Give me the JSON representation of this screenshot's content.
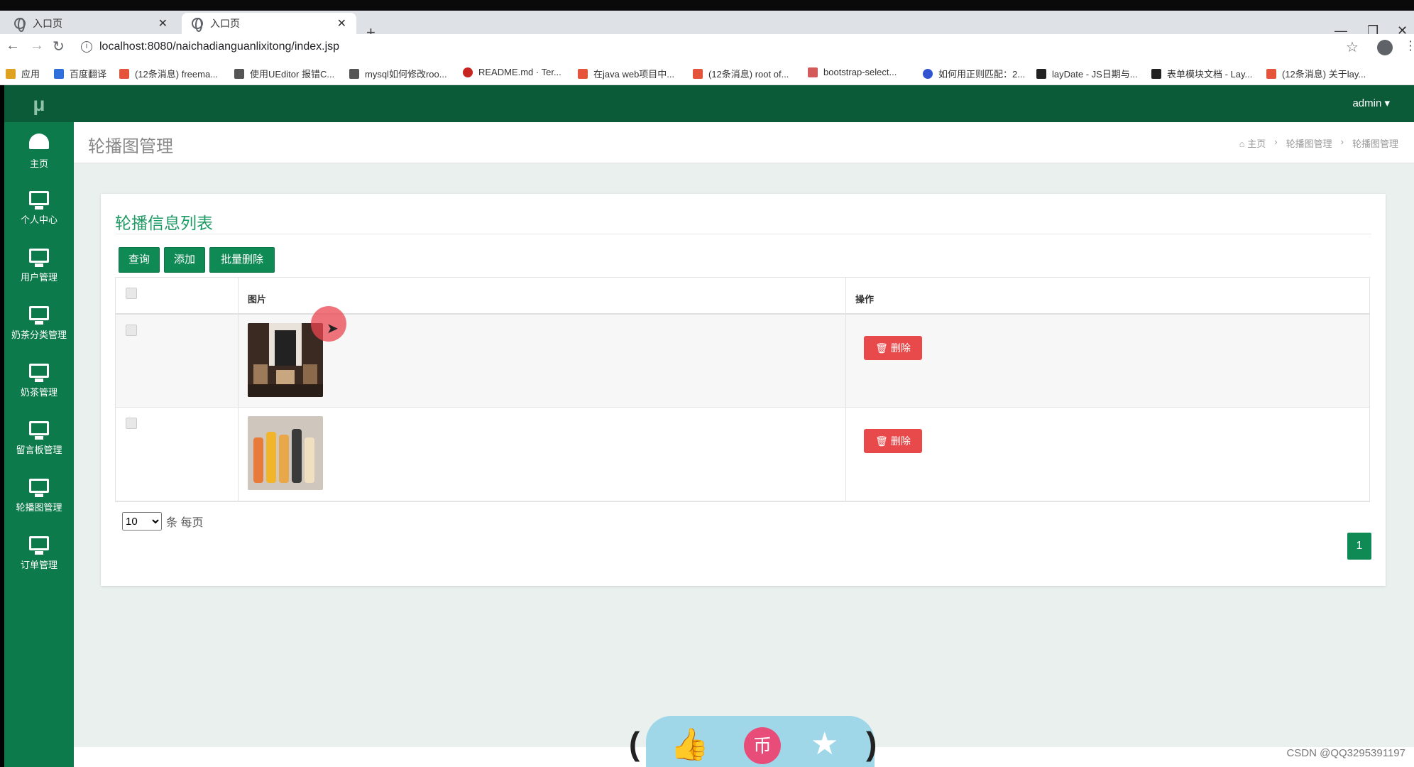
{
  "browser": {
    "tabs": [
      {
        "title": "入口页",
        "active": false
      },
      {
        "title": "入口页",
        "active": true
      }
    ],
    "new_tab": "+",
    "url": "localhost:8080/naichadianguanlixitong/index.jsp",
    "bookmarks": [
      "应用",
      "百度翻译",
      "(12条消息) freema...",
      "使用UEditor 报错C...",
      "mysql如何修改roo...",
      "README.md · Ter...",
      "在java web项目中...",
      "(12条消息) root of...",
      "bootstrap-select...",
      "如何用正则匹配：2...",
      "layDate - JS日期与...",
      "表单模块文档 - Lay...",
      "(12条消息) 关于lay..."
    ]
  },
  "app": {
    "logo": "μ",
    "user": "admin ▾",
    "sidebar": {
      "items": [
        {
          "label": "主页",
          "icon": "dashboard-icon"
        },
        {
          "label": "个人中心",
          "icon": "monitor-icon"
        },
        {
          "label": "用户管理",
          "icon": "monitor-icon"
        },
        {
          "label": "奶茶分类管理",
          "icon": "monitor-icon"
        },
        {
          "label": "奶茶管理",
          "icon": "monitor-icon"
        },
        {
          "label": "留言板管理",
          "icon": "monitor-icon"
        },
        {
          "label": "轮播图管理",
          "icon": "monitor-icon"
        },
        {
          "label": "订单管理",
          "icon": "monitor-icon"
        }
      ]
    },
    "page_title": "轮播图管理",
    "breadcrumb": [
      "主页",
      "轮播图管理",
      "轮播图管理"
    ],
    "breadcrumb_sep": "›",
    "card": {
      "title": "轮播信息列表",
      "buttons": {
        "query": "查询",
        "add": "添加",
        "batch_delete": "批量删除"
      },
      "table": {
        "headers": {
          "image": "图片",
          "action": "操作"
        },
        "rows": [
          {
            "delete_label": "删除"
          },
          {
            "delete_label": "删除"
          }
        ]
      },
      "page_size": "10",
      "page_size_suffix": "条 每页",
      "current_page": "1"
    },
    "colors": {
      "sidebar": "#0c7a4a",
      "topbar": "#0b5a38",
      "primary": "#0f8a55",
      "danger": "#e8494a"
    }
  },
  "watermark": "CSDN @QQ3295391197"
}
